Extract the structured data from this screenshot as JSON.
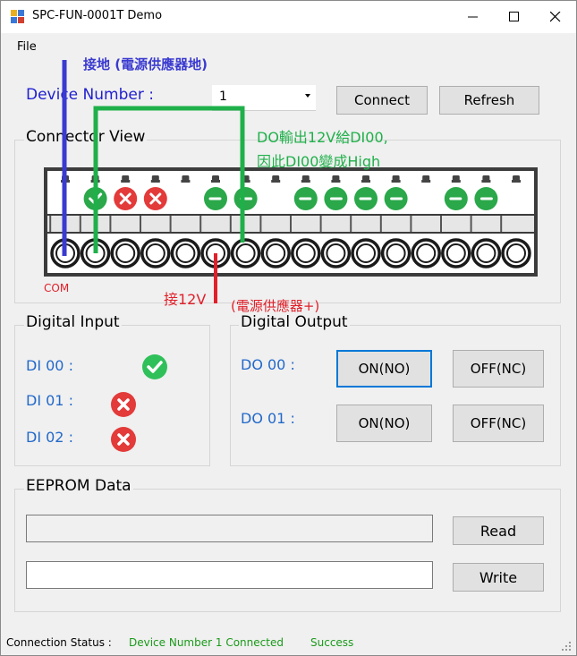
{
  "window": {
    "title": "SPC-FUN-0001T Demo"
  },
  "menu": {
    "file": "File"
  },
  "device": {
    "label": "Device Number :",
    "selected": "1",
    "connect": "Connect",
    "refresh": "Refresh"
  },
  "connector": {
    "title": "Connector View",
    "com_label": "COM",
    "slots": [
      "",
      "check",
      "x",
      "x",
      "",
      "arrow-right",
      "arrow-left",
      "",
      "arrow-right",
      "arrow-left",
      "arrow-right",
      "arrow-left",
      "",
      "arrow-right",
      "arrow-left",
      ""
    ]
  },
  "annotations": {
    "ground": "接地 (電源供應器地)",
    "do_to_di_1": "DO輸出12V給DI00,",
    "do_to_di_2": "因此DI00變成High",
    "v12": "接12V",
    "power_plus": "(電源供應器+)",
    "colors": {
      "blue": "#3a3ad0",
      "green": "#1fb04a",
      "red": "#e0202a"
    }
  },
  "digital_input": {
    "title": "Digital Input",
    "items": [
      {
        "label": "DI 00 :",
        "state": "check"
      },
      {
        "label": "DI 01 :",
        "state": "x"
      },
      {
        "label": "DI 02 :",
        "state": "x"
      }
    ]
  },
  "digital_output": {
    "title": "Digital Output",
    "items": [
      {
        "label": "DO 00 :",
        "on": "ON(NO)",
        "off": "OFF(NC)"
      },
      {
        "label": "DO 01 :",
        "on": "ON(NO)",
        "off": "OFF(NC)"
      }
    ]
  },
  "eeprom": {
    "title": "EEPROM Data",
    "read": "Read",
    "write": "Write",
    "read_value": "",
    "write_value": ""
  },
  "status": {
    "label": "Connection Status :",
    "connected": "Device Number 1 Connected",
    "result": "Success",
    "ok_color": "#1a9a1a"
  }
}
